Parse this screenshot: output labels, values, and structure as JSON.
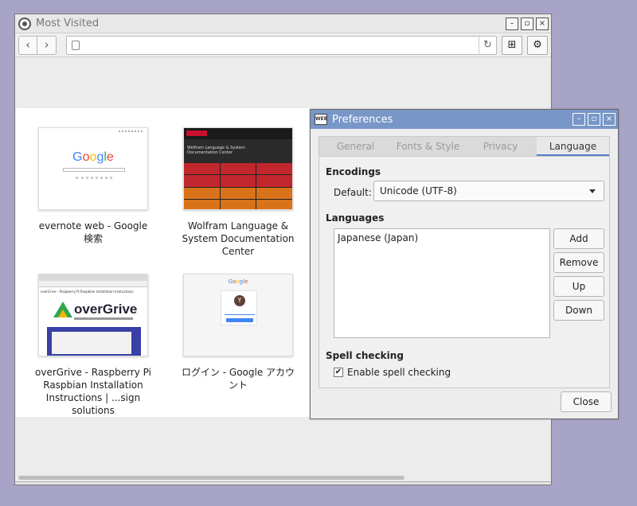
{
  "browser": {
    "title": "Most Visited",
    "window_buttons": {
      "minimize": "–",
      "maximize": "▫",
      "close": "×"
    },
    "nav": {
      "back": "‹",
      "forward": "›"
    },
    "url": "",
    "tiles": [
      {
        "label": "evernote web - Google 検索",
        "thumb_logo": "Google"
      },
      {
        "label": "Wolfram Language & System Documentation Center",
        "thumb_logo": "WOLFRAM"
      },
      {
        "label": "overGrive - Raspberry Pi Raspbian Installation Instructions | ...sign solutions",
        "thumb_logo": "overGrive"
      },
      {
        "label": "ログイン - Google アカウント",
        "thumb_logo": "Google"
      }
    ]
  },
  "preferences": {
    "title": "Preferences",
    "tabs": [
      "General",
      "Fonts & Style",
      "Privacy",
      "Language"
    ],
    "active_tab": "Language",
    "encodings_heading": "Encodings",
    "default_label": "Default:",
    "default_encoding": "Unicode (UTF-8)",
    "languages_heading": "Languages",
    "languages": [
      "Japanese (Japan)"
    ],
    "buttons": {
      "add": "Add",
      "remove": "Remove",
      "up": "Up",
      "down": "Down",
      "close": "Close"
    },
    "spell_heading": "Spell checking",
    "spell_label": "Enable spell checking",
    "spell_checked": true
  }
}
